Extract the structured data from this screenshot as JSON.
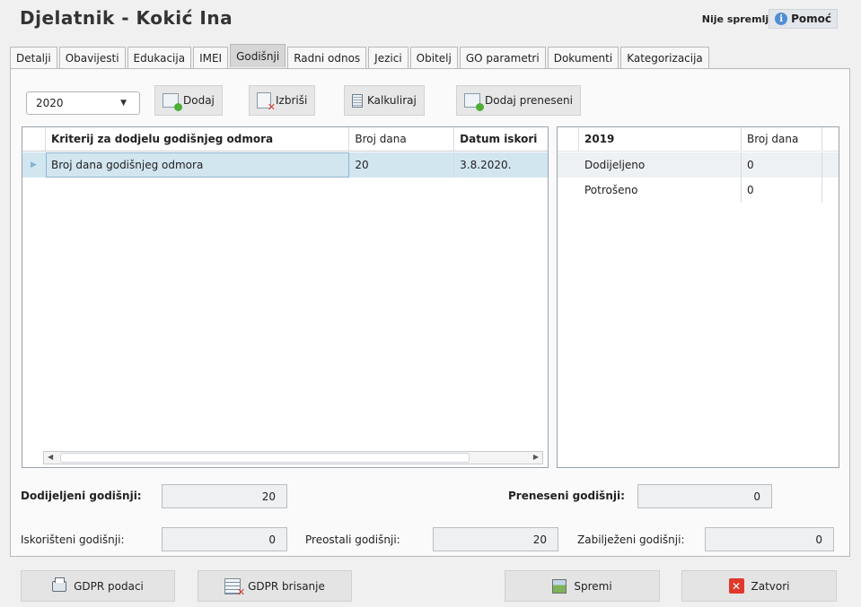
{
  "header": {
    "title": "Djelatnik - Kokić Ina",
    "status": "Nije spremljeno",
    "help_label": "Pomoć",
    "help_icon": "info-icon"
  },
  "tabs": [
    {
      "label": "Detalji",
      "active": false
    },
    {
      "label": "Obavijesti",
      "active": false
    },
    {
      "label": "Edukacija",
      "active": false
    },
    {
      "label": "IMEI",
      "active": false
    },
    {
      "label": "Godišnji",
      "active": true
    },
    {
      "label": "Radni odnos",
      "active": false
    },
    {
      "label": "Jezici",
      "active": false
    },
    {
      "label": "Obitelj",
      "active": false
    },
    {
      "label": "GO parametri",
      "active": false
    },
    {
      "label": "Dokumenti",
      "active": false
    },
    {
      "label": "Kategorizacija",
      "active": false
    }
  ],
  "toolbar": {
    "year_value": "2020",
    "add_label": "Dodaj",
    "delete_label": "Izbriši",
    "calculate_label": "Kalkuliraj",
    "add_carried_label": "Dodaj preneseni"
  },
  "main_grid": {
    "columns": [
      "Kriterij za dodjelu godišnjeg odmora",
      "Broj dana",
      "Datum iskori"
    ],
    "rows": [
      {
        "criterion": "Broj dana godišnjeg odmora",
        "days": "20",
        "date": "3.8.2020."
      }
    ]
  },
  "side_grid": {
    "columns": [
      "2019",
      "Broj dana"
    ],
    "rows": [
      {
        "label": "Dodijeljeno",
        "days": "0"
      },
      {
        "label": "Potrošeno",
        "days": "0"
      }
    ]
  },
  "summary": {
    "assigned_label": "Dodijeljeni godišnji:",
    "assigned_value": "20",
    "carried_label": "Preneseni godišnji:",
    "carried_value": "0",
    "used_label": "Iskorišteni godišnji:",
    "used_value": "0",
    "remaining_label": "Preostali godišnji:",
    "remaining_value": "20",
    "recorded_label": "Zabilježeni godišnji:",
    "recorded_value": "0"
  },
  "footer": {
    "gdpr_data_label": "GDPR podaci",
    "gdpr_delete_label": "GDPR brisanje",
    "save_label": "Spremi",
    "close_label": "Zatvori"
  },
  "colors": {
    "selected_row": "#d2e6f0",
    "active_tab": "#d6d6d6",
    "info_icon": "#4f8fd6",
    "close_icon": "#e0392b"
  }
}
